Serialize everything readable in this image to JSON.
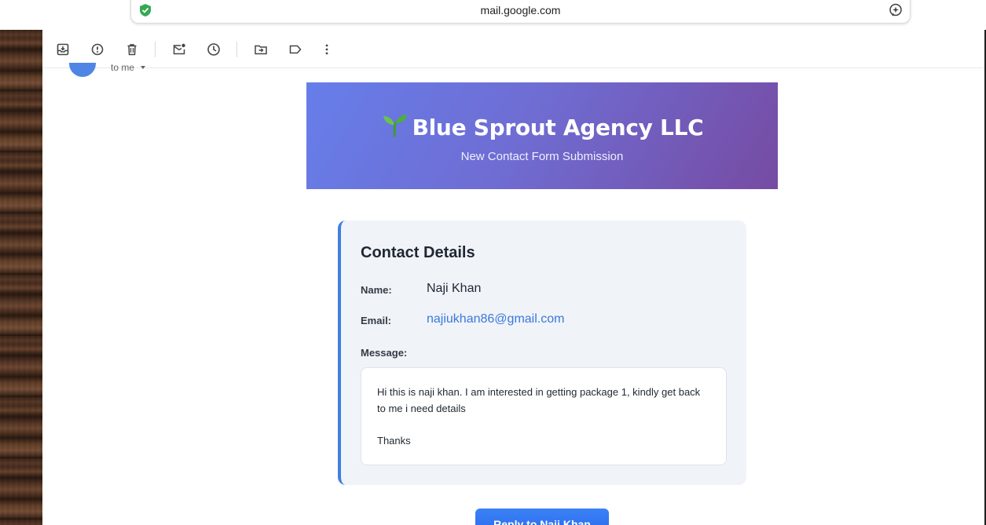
{
  "browser": {
    "url": "mail.google.com"
  },
  "toolbar": {
    "icons": [
      "archive-icon",
      "report-spam-icon",
      "delete-icon",
      "mark-unread-icon",
      "snooze-icon",
      "move-to-icon",
      "label-icon",
      "more-vert-icon"
    ]
  },
  "sender": {
    "to_line": "to me"
  },
  "email": {
    "banner": {
      "title": "Blue Sprout Agency LLC",
      "subtitle": "New Contact Form Submission",
      "gradient": [
        "#667eea",
        "#764ba2"
      ]
    },
    "card": {
      "heading": "Contact Details",
      "name_label": "Name:",
      "name_value": "Naji Khan",
      "email_label": "Email:",
      "email_value": "najiukhan86@gmail.com",
      "message_label": "Message:",
      "message_line1": "Hi this is naji khan. I am interested in getting package 1, kindly get back to me i need details",
      "message_line2": "Thanks"
    },
    "reply_button": "Reply to Naji Khan"
  },
  "colors": {
    "accent": "#3f7ee4",
    "link": "#3a78dc",
    "card_bg": "#f0f3f8"
  }
}
